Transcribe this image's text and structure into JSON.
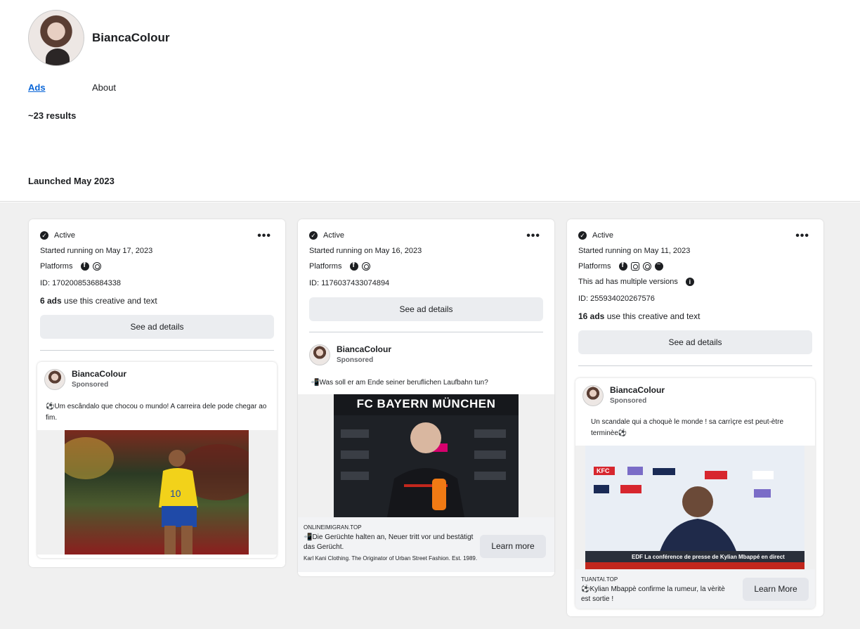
{
  "profile": {
    "name": "BiancaColour"
  },
  "tabs": [
    {
      "label": "Ads"
    },
    {
      "label": "About"
    }
  ],
  "results": "~23 results",
  "section_heading": "Launched May 2023",
  "cards": [
    {
      "status": "Active",
      "started": "Started running on May 17, 2023",
      "platforms_label": "Platforms",
      "platforms": [
        "facebook-icon",
        "audience-network-icon"
      ],
      "id": "ID: 1702008536884338",
      "ads_count_bold": "6 ads",
      "ads_count_rest": " use this creative and text",
      "see_details": "See ad details",
      "ad": {
        "name": "BiancaColour",
        "sponsored": "Sponsored",
        "text": "⚽Um escândalo que chocou o mundo! A carreira dele pode chegar ao fim."
      }
    },
    {
      "status": "Active",
      "started": "Started running on May 16, 2023",
      "platforms_label": "Platforms",
      "platforms": [
        "facebook-icon",
        "audience-network-icon"
      ],
      "id": "ID: 1176037433074894",
      "see_details": "See ad details",
      "ad": {
        "name": "BiancaColour",
        "sponsored": "Sponsored",
        "text": "📲Was soll er am Ende seiner beruflichen Laufbahn tun?",
        "image_banner": "FC BAYERN MÜNCHEN",
        "domain": "ONLINEIMIGRAN.TOP",
        "headline": "📲Die Gerüchte halten an, Neuer tritt vor und bestätigt das Gerücht.",
        "description": "Karl Kani Clothing. The Originator of Urban Street Fashion. Est. 1989.",
        "cta": "Learn more"
      }
    },
    {
      "status": "Active",
      "started": "Started running on May 11, 2023",
      "platforms_label": "Platforms",
      "platforms": [
        "facebook-icon",
        "instagram-icon",
        "audience-network-icon",
        "messenger-icon"
      ],
      "versions": "This ad has multiple versions",
      "id": "ID: 255934020267576",
      "ads_count_bold": "16 ads",
      "ads_count_rest": " use this creative and text",
      "see_details": "See ad details",
      "ad": {
        "name": "BiancaColour",
        "sponsored": "Sponsored",
        "text": "Un scandale qui a choquè le monde ! sa carrìçre est peut-ètre terminèe⚽",
        "image_ticker": "EDF La conférence de presse de Kylian Mbappé en direct",
        "domain": "TUANTAI.TOP",
        "headline": "⚽Kylian Mbappè confirme la rumeur, la vèritè est sortie !",
        "cta": "Learn More"
      }
    }
  ],
  "colors": {
    "link": "#0a66d8",
    "grid_bg": "#f0f0f0",
    "button_bg": "#ebedf0"
  }
}
